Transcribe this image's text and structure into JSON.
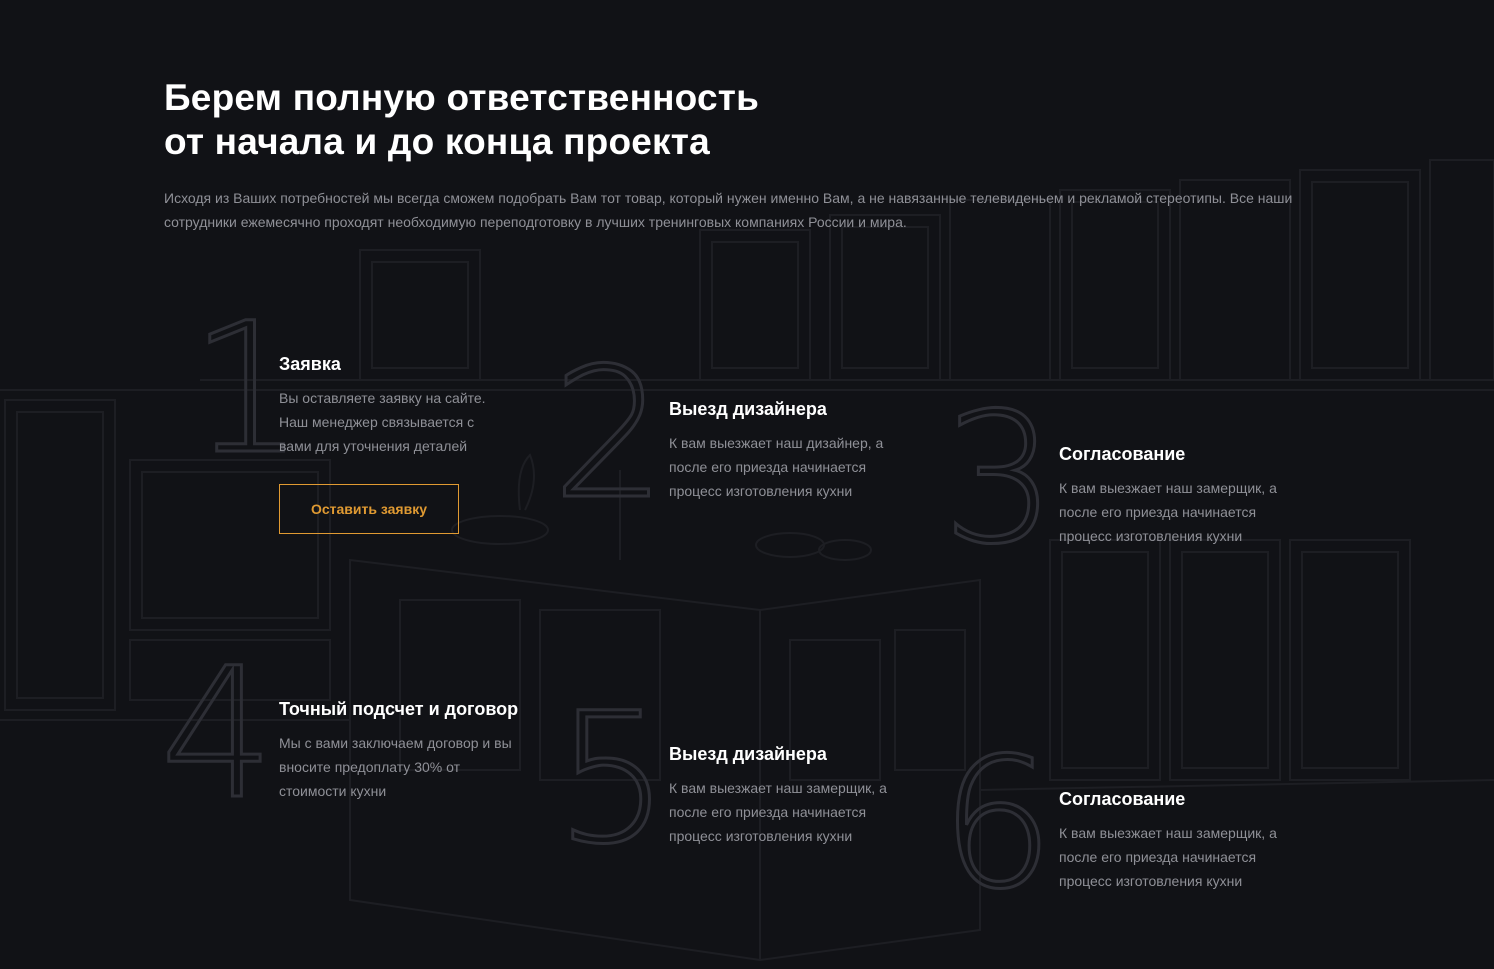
{
  "section": {
    "title_line1": "Берем полную ответственность",
    "title_line2": "от начала и до конца проекта",
    "intro": "Исходя из Ваших потребностей мы всегда сможем подобрать Вам тот товар, который нужен именно Вам, а не навязанные телевиденьем и рекламой стереотипы. Все наши сотрудники ежемесячно проходят необходимую переподготовку в лучших тренинговых компаниях России и мира."
  },
  "steps": [
    {
      "number": "1",
      "title": "Заявка",
      "text": "Вы оставляете заявку на сайте. Наш менеджер связывается с вами для уточнения деталей"
    },
    {
      "number": "2",
      "title": "Выезд дизайнера",
      "text": "К вам выезжает наш дизайнер, а после его приезда начинается процесс изготовления кухни"
    },
    {
      "number": "3",
      "title": "Согласование",
      "text": "К вам выезжает наш замерщик, а после его приезда начинается процесс изготовления кухни"
    },
    {
      "number": "4",
      "title": "Точный подсчет и договор",
      "text": "Мы с вами заключаем договор и вы вносите предоплату 30% от стоимости кухни"
    },
    {
      "number": "5",
      "title": "Выезд дизайнера",
      "text": "К вам выезжает наш замерщик, а после его приезда начинается процесс изготовления кухни"
    },
    {
      "number": "6",
      "title": "Согласование",
      "text": "К вам выезжает наш замерщик, а после его приезда начинается процесс изготовления кухни"
    }
  ],
  "cta": {
    "label": "Оставить заявку"
  },
  "colors": {
    "background": "#111216",
    "accent": "#e09a32",
    "muted_text": "#8f9097",
    "number_stroke": "#2d2e35"
  },
  "background_image": "kitchen-sketch-illustration"
}
